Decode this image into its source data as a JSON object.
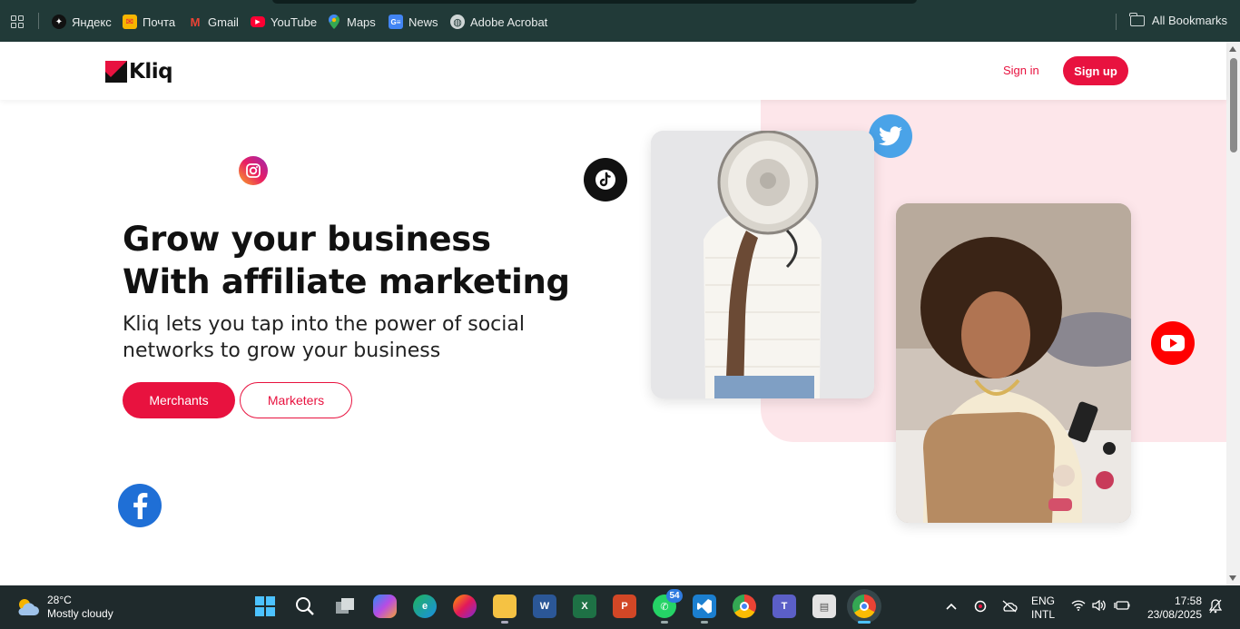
{
  "bookmarks": {
    "items": [
      {
        "label": "Яндекс",
        "icon": "yandex-icon"
      },
      {
        "label": "Почта",
        "icon": "mail-envelope-icon"
      },
      {
        "label": "Gmail",
        "icon": "gmail-icon"
      },
      {
        "label": "YouTube",
        "icon": "youtube-icon"
      },
      {
        "label": "Maps",
        "icon": "maps-pin-icon"
      },
      {
        "label": "News",
        "icon": "news-icon"
      },
      {
        "label": "Adobe Acrobat",
        "icon": "globe-icon"
      }
    ],
    "all_bookmarks": "All Bookmarks"
  },
  "site": {
    "logo_text": "Kliq",
    "sign_in": "Sign in",
    "sign_up": "Sign up",
    "brand_color": "#e8123f"
  },
  "hero": {
    "title_line1": "Grow your business",
    "title_line2": "With affiliate marketing",
    "subtitle": "Kliq lets you tap into the power of social networks to grow your business",
    "btn_merchants": "Merchants",
    "btn_marketers": "Marketers"
  },
  "taskbar": {
    "weather_temp": "28°C",
    "weather_desc": "Mostly cloudy",
    "whatsapp_badge": "54",
    "lang_top": "ENG",
    "lang_bottom": "INTL",
    "time": "17:58",
    "date": "23/08/2025"
  }
}
